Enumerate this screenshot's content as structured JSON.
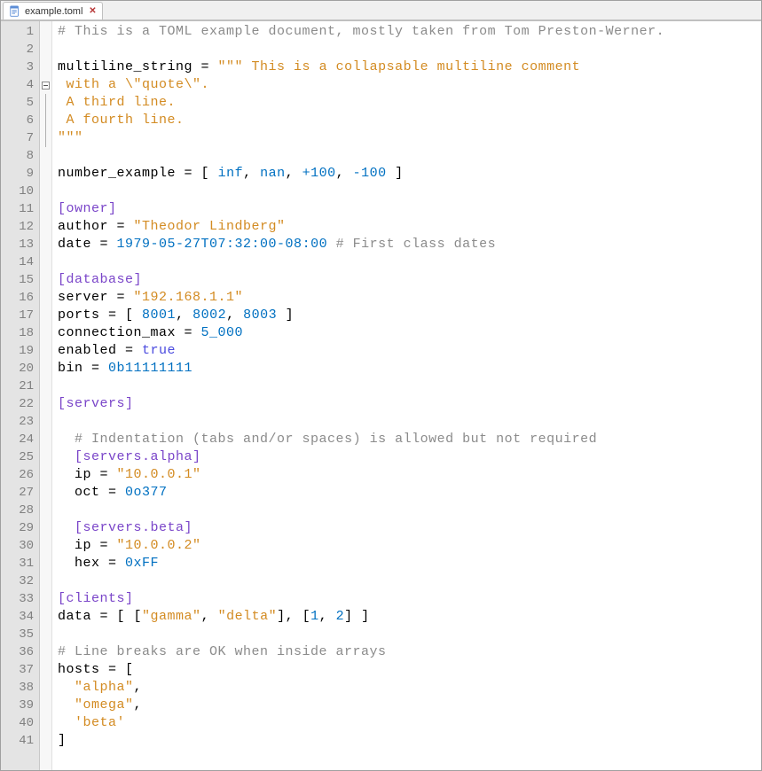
{
  "tab": {
    "filename": "example.toml",
    "close_glyph": "✕"
  },
  "fold_at_line": 4,
  "fold_span": 3,
  "code_lines": [
    [
      {
        "cls": "c-comment",
        "t": "# This is a TOML example document, mostly taken from Tom Preston-Werner."
      }
    ],
    [],
    [
      {
        "cls": "c-key",
        "t": "multiline_string"
      },
      {
        "cls": "c-op",
        "t": " = "
      },
      {
        "cls": "c-string",
        "t": "\"\"\" This is a collapsable multiline comment"
      }
    ],
    [
      {
        "cls": "c-string",
        "t": " with a \\\"quote\\\"."
      }
    ],
    [
      {
        "cls": "c-string",
        "t": " A third line."
      }
    ],
    [
      {
        "cls": "c-string",
        "t": " A fourth line."
      }
    ],
    [
      {
        "cls": "c-string",
        "t": "\"\"\""
      }
    ],
    [],
    [
      {
        "cls": "c-key",
        "t": "number_example"
      },
      {
        "cls": "c-op",
        "t": " = "
      },
      {
        "cls": "c-punc",
        "t": "[ "
      },
      {
        "cls": "c-number",
        "t": "inf"
      },
      {
        "cls": "c-punc",
        "t": ", "
      },
      {
        "cls": "c-number",
        "t": "nan"
      },
      {
        "cls": "c-punc",
        "t": ", "
      },
      {
        "cls": "c-number",
        "t": "+100"
      },
      {
        "cls": "c-punc",
        "t": ", "
      },
      {
        "cls": "c-number",
        "t": "-100"
      },
      {
        "cls": "c-punc",
        "t": " ]"
      }
    ],
    [],
    [
      {
        "cls": "c-section",
        "t": "[owner]"
      }
    ],
    [
      {
        "cls": "c-key",
        "t": "author"
      },
      {
        "cls": "c-op",
        "t": " = "
      },
      {
        "cls": "c-string",
        "t": "\"Theodor Lindberg\""
      }
    ],
    [
      {
        "cls": "c-key",
        "t": "date"
      },
      {
        "cls": "c-op",
        "t": " = "
      },
      {
        "cls": "c-date",
        "t": "1979-05-27T07:32:00-08:00"
      },
      {
        "cls": "c-comment",
        "t": " # First class dates"
      }
    ],
    [],
    [
      {
        "cls": "c-section",
        "t": "[database]"
      }
    ],
    [
      {
        "cls": "c-key",
        "t": "server"
      },
      {
        "cls": "c-op",
        "t": " = "
      },
      {
        "cls": "c-string",
        "t": "\"192.168.1.1\""
      }
    ],
    [
      {
        "cls": "c-key",
        "t": "ports"
      },
      {
        "cls": "c-op",
        "t": " = "
      },
      {
        "cls": "c-punc",
        "t": "[ "
      },
      {
        "cls": "c-number",
        "t": "8001"
      },
      {
        "cls": "c-punc",
        "t": ", "
      },
      {
        "cls": "c-number",
        "t": "8002"
      },
      {
        "cls": "c-punc",
        "t": ", "
      },
      {
        "cls": "c-number",
        "t": "8003"
      },
      {
        "cls": "c-punc",
        "t": " ]"
      }
    ],
    [
      {
        "cls": "c-key",
        "t": "connection_max"
      },
      {
        "cls": "c-op",
        "t": " = "
      },
      {
        "cls": "c-number",
        "t": "5_000"
      }
    ],
    [
      {
        "cls": "c-key",
        "t": "enabled"
      },
      {
        "cls": "c-op",
        "t": " = "
      },
      {
        "cls": "c-bool",
        "t": "true"
      }
    ],
    [
      {
        "cls": "c-key",
        "t": "bin"
      },
      {
        "cls": "c-op",
        "t": " = "
      },
      {
        "cls": "c-number",
        "t": "0b11111111"
      }
    ],
    [],
    [
      {
        "cls": "c-section",
        "t": "[servers]"
      }
    ],
    [],
    [
      {
        "cls": "",
        "t": "  "
      },
      {
        "cls": "c-comment",
        "t": "# Indentation (tabs and/or spaces) is allowed but not required"
      }
    ],
    [
      {
        "cls": "",
        "t": "  "
      },
      {
        "cls": "c-section",
        "t": "[servers.alpha]"
      }
    ],
    [
      {
        "cls": "",
        "t": "  "
      },
      {
        "cls": "c-key",
        "t": "ip"
      },
      {
        "cls": "c-op",
        "t": " = "
      },
      {
        "cls": "c-string",
        "t": "\"10.0.0.1\""
      }
    ],
    [
      {
        "cls": "",
        "t": "  "
      },
      {
        "cls": "c-key",
        "t": "oct"
      },
      {
        "cls": "c-op",
        "t": " = "
      },
      {
        "cls": "c-number",
        "t": "0o377"
      }
    ],
    [],
    [
      {
        "cls": "",
        "t": "  "
      },
      {
        "cls": "c-section",
        "t": "[servers.beta]"
      }
    ],
    [
      {
        "cls": "",
        "t": "  "
      },
      {
        "cls": "c-key",
        "t": "ip"
      },
      {
        "cls": "c-op",
        "t": " = "
      },
      {
        "cls": "c-string",
        "t": "\"10.0.0.2\""
      }
    ],
    [
      {
        "cls": "",
        "t": "  "
      },
      {
        "cls": "c-key",
        "t": "hex"
      },
      {
        "cls": "c-op",
        "t": " = "
      },
      {
        "cls": "c-number",
        "t": "0xFF"
      }
    ],
    [],
    [
      {
        "cls": "c-section",
        "t": "[clients]"
      }
    ],
    [
      {
        "cls": "c-key",
        "t": "data"
      },
      {
        "cls": "c-op",
        "t": " = "
      },
      {
        "cls": "c-punc",
        "t": "[ ["
      },
      {
        "cls": "c-string",
        "t": "\"gamma\""
      },
      {
        "cls": "c-punc",
        "t": ", "
      },
      {
        "cls": "c-string",
        "t": "\"delta\""
      },
      {
        "cls": "c-punc",
        "t": "], ["
      },
      {
        "cls": "c-number",
        "t": "1"
      },
      {
        "cls": "c-punc",
        "t": ", "
      },
      {
        "cls": "c-number",
        "t": "2"
      },
      {
        "cls": "c-punc",
        "t": "] ]"
      }
    ],
    [],
    [
      {
        "cls": "c-comment",
        "t": "# Line breaks are OK when inside arrays"
      }
    ],
    [
      {
        "cls": "c-key",
        "t": "hosts"
      },
      {
        "cls": "c-op",
        "t": " = "
      },
      {
        "cls": "c-punc",
        "t": "["
      }
    ],
    [
      {
        "cls": "",
        "t": "  "
      },
      {
        "cls": "c-string",
        "t": "\"alpha\""
      },
      {
        "cls": "c-punc",
        "t": ","
      }
    ],
    [
      {
        "cls": "",
        "t": "  "
      },
      {
        "cls": "c-string",
        "t": "\"omega\""
      },
      {
        "cls": "c-punc",
        "t": ","
      }
    ],
    [
      {
        "cls": "",
        "t": "  "
      },
      {
        "cls": "c-string",
        "t": "'beta'"
      }
    ],
    [
      {
        "cls": "c-punc",
        "t": "]"
      }
    ]
  ]
}
